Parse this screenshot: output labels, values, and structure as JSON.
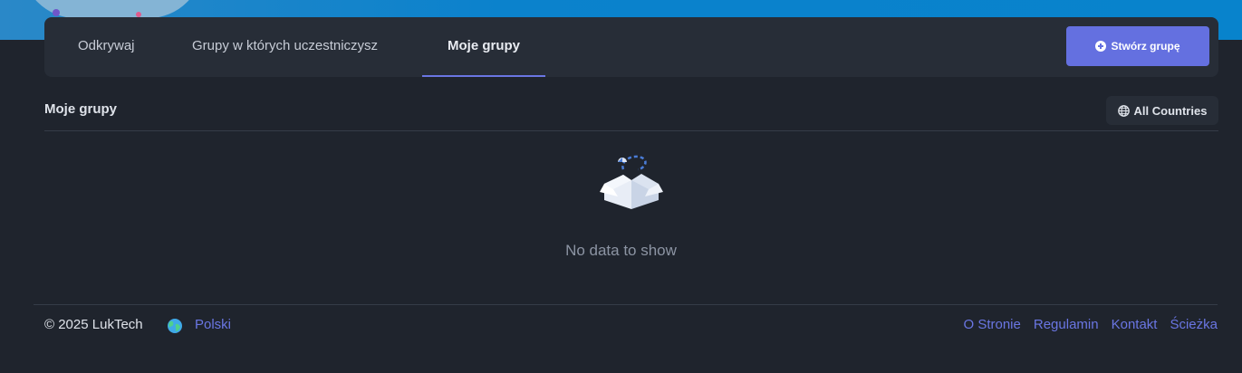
{
  "tabs": [
    {
      "label": "Odkrywaj"
    },
    {
      "label": "Grupy w których uczestniczysz"
    },
    {
      "label": "Moje grupy",
      "active": true
    }
  ],
  "actions": {
    "create_group_label": "Stwórz grupę"
  },
  "section": {
    "title": "Moje grupy"
  },
  "filter": {
    "country_label": "All Countries",
    "icon": "globe-icon"
  },
  "empty_state": {
    "message": "No data to show",
    "icon": "open-box-icon"
  },
  "footer": {
    "copyright": "© 2025 LukTech",
    "language": "Polski",
    "links": [
      "O Stronie",
      "Regulamin",
      "Kontakt",
      "Ścieżka"
    ]
  },
  "colors": {
    "accent": "#6470e0",
    "background": "#1f242d",
    "card": "#272d37",
    "hero": "#0883cc"
  }
}
